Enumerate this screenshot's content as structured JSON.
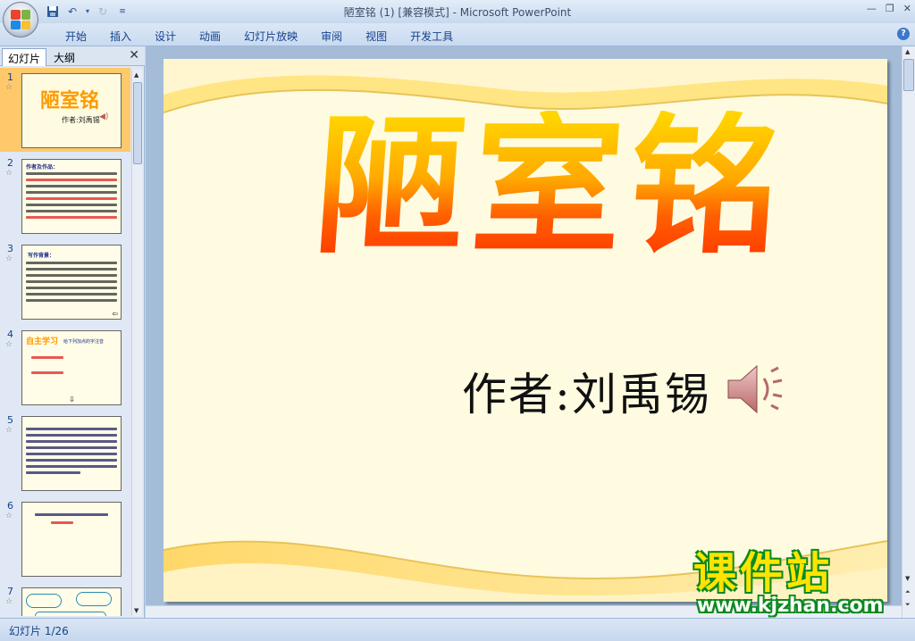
{
  "window": {
    "title": "陋室铭 (1) [兼容模式] - Microsoft PowerPoint"
  },
  "ribbon": {
    "tabs": [
      "开始",
      "插入",
      "设计",
      "动画",
      "幻灯片放映",
      "审阅",
      "视图",
      "开发工具"
    ]
  },
  "left_panel": {
    "tab_slides": "幻灯片",
    "tab_outline": "大纲",
    "thumbnails": [
      {
        "number": "1",
        "title": "陋室铭",
        "author": "作者:刘禹锡"
      },
      {
        "number": "2",
        "heading": "作者及作品："
      },
      {
        "number": "3",
        "heading": "写作背景："
      },
      {
        "number": "4",
        "heading": "自主学习",
        "subheading": "给下列加点的字注音"
      },
      {
        "number": "5"
      },
      {
        "number": "6"
      },
      {
        "number": "7"
      }
    ]
  },
  "slide": {
    "title": "陋室铭",
    "author": "作者:刘禹锡"
  },
  "status": {
    "slide_counter": "幻灯片 1/26"
  },
  "watermark": {
    "text": "课件站",
    "url": "www.kjzhan.com"
  },
  "colors": {
    "accent": "#15428b",
    "selected_thumb": "#ffc86b",
    "title_gradient_top": "#ffd800",
    "title_gradient_bottom": "#ff3800"
  }
}
